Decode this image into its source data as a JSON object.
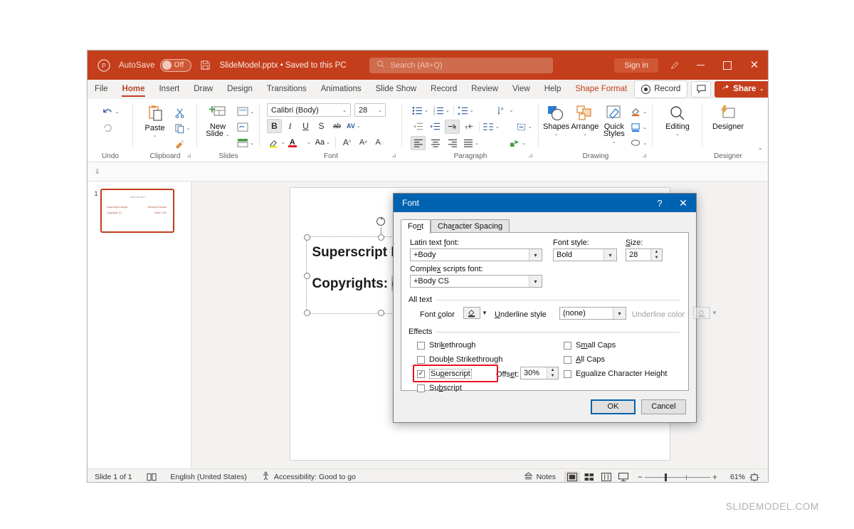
{
  "titlebar": {
    "app_icon": "powerpoint-icon",
    "autosave_label": "AutoSave",
    "autosave_state": "Off",
    "save_icon": "save-icon",
    "filename": "SlideModel.pptx • Saved to this PC",
    "filename_chevron": "⌄",
    "search_icon": "search-icon",
    "search_placeholder": "Search (Alt+Q)",
    "signin_label": "Sign in",
    "ink_icon": "pen-icon",
    "minimize": "minimize-icon",
    "maximize": "maximize-icon",
    "close": "close-icon"
  },
  "tabs": [
    {
      "label": "File",
      "active": false
    },
    {
      "label": "Home",
      "active": true
    },
    {
      "label": "Insert",
      "active": false
    },
    {
      "label": "Draw",
      "active": false
    },
    {
      "label": "Design",
      "active": false
    },
    {
      "label": "Transitions",
      "active": false
    },
    {
      "label": "Animations",
      "active": false
    },
    {
      "label": "Slide Show",
      "active": false
    },
    {
      "label": "Record",
      "active": false
    },
    {
      "label": "Review",
      "active": false
    },
    {
      "label": "View",
      "active": false
    },
    {
      "label": "Help",
      "active": false
    },
    {
      "label": "Shape Format",
      "contextual": true
    }
  ],
  "tabbar_right": {
    "record_label": "Record",
    "comment_icon": "comment-icon",
    "share_label": "Share",
    "share_chevron": "⌄",
    "share_color": "#c43e1c"
  },
  "ribbon": {
    "groups": [
      {
        "name": "Undo",
        "label": "Undo"
      },
      {
        "name": "Clipboard",
        "label": "Clipboard",
        "paste_label": "Paste",
        "launcher": "⊿"
      },
      {
        "name": "Slides",
        "label": "Slides",
        "new_slide_label": "New\nSlide"
      },
      {
        "name": "Font",
        "label": "Font",
        "launcher": "⊿",
        "font_name": "Calibri (Body)",
        "font_size": "28",
        "bold": "B",
        "italic": "I",
        "underline": "U",
        "strike": "S",
        "shadow": "ab",
        "spacing": "AV",
        "case_label": "Aa",
        "grow": "A",
        "shrink": "A",
        "clear": "A"
      },
      {
        "name": "Paragraph",
        "label": "Paragraph",
        "launcher": "⊿"
      },
      {
        "name": "Drawing",
        "label": "Drawing",
        "launcher": "⊿",
        "shapes_label": "Shapes",
        "arrange_label": "Arrange",
        "quick_styles_label": "Quick\nStyles"
      },
      {
        "name": "Editing",
        "label": "",
        "editing_label": "Editing"
      },
      {
        "name": "Designer",
        "label": "Designer",
        "designer_label": "Designer"
      }
    ],
    "collapse_icon": "chevron-down-icon"
  },
  "thumbnail_panel": {
    "slide_number": "1",
    "slide_title": "SlideModel",
    "line_left_1": "Superscript Example",
    "line_left_2": "Copyrights: (C)",
    "line_right_1": "Subscript Example",
    "line_right_2": "Water: H2O"
  },
  "slide": {
    "line1": "Superscript Example",
    "line2_prefix": "Copyrights: ",
    "line2_selected": "(C)",
    "rotate_handle": "rotate-handle-icon"
  },
  "dialog": {
    "title": "Font",
    "help_icon": "?",
    "close_icon": "✕",
    "tabs": [
      {
        "label": "Font",
        "active": true
      },
      {
        "label": "Character Spacing",
        "active": false
      }
    ],
    "latin_font_label": "Latin text font:",
    "latin_font_value": "+Body",
    "complex_font_label": "Complex scripts font:",
    "complex_font_value": "+Body CS",
    "font_style_label": "Font style:",
    "font_style_value": "Bold",
    "size_label": "Size:",
    "size_value": "28",
    "all_text_group": "All text",
    "font_color_label": "Font color",
    "underline_style_label": "Underline style",
    "underline_style_value": "(none)",
    "underline_color_label": "Underline color",
    "effects_group": "Effects",
    "effects_left": [
      {
        "label": "Strikethrough",
        "checked": false
      },
      {
        "label": "Double Strikethrough",
        "checked": false
      },
      {
        "label": "Superscript",
        "checked": true,
        "highlighted": true
      },
      {
        "label": "Subscript",
        "checked": false
      }
    ],
    "effects_right": [
      {
        "label": "Small Caps",
        "checked": false
      },
      {
        "label": "All Caps",
        "checked": false
      },
      {
        "label": "Equalize Character Height",
        "checked": false
      }
    ],
    "offset_label": "Offset:",
    "offset_value": "30%",
    "ok_label": "OK",
    "cancel_label": "Cancel",
    "highlight_color": "#e81123",
    "titlebar_color": "#0063b1"
  },
  "status_bar": {
    "slide_count": "Slide 1 of 1",
    "notes_page_icon": "notes-page-icon",
    "language": "English (United States)",
    "accessibility_icon": "accessibility-icon",
    "accessibility": "Accessibility: Good to go",
    "notes_label": "Notes",
    "view_normal": "normal-view-icon",
    "view_sorter": "slide-sorter-icon",
    "view_reading": "reading-view-icon",
    "view_slideshow": "slideshow-icon",
    "zoom_out": "−",
    "zoom_in": "+",
    "zoom_level": "61%",
    "fit_icon": "fit-slide-icon"
  },
  "watermark": "SLIDEMODEL.COM"
}
